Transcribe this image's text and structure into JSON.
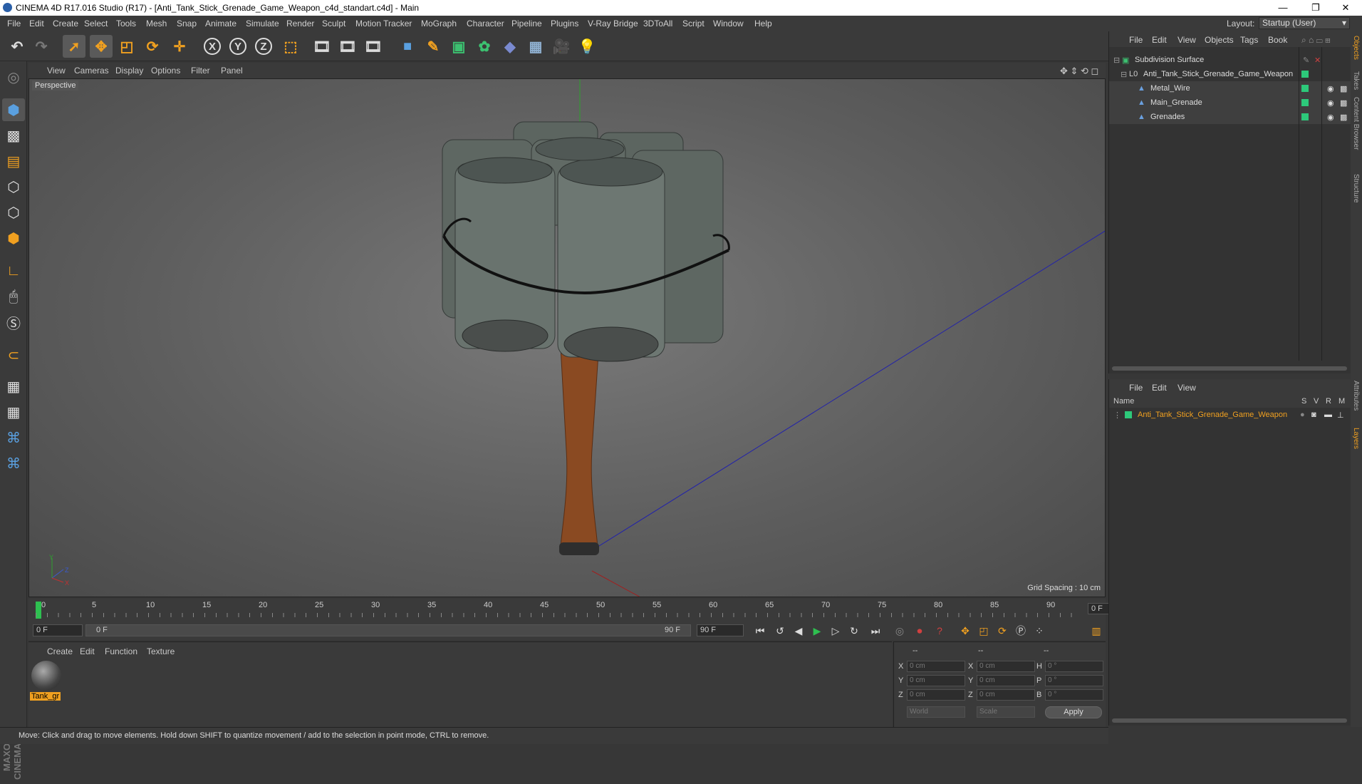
{
  "window": {
    "title": "CINEMA 4D R17.016 Studio (R17) - [Anti_Tank_Stick_Grenade_Game_Weapon_c4d_standart.c4d] - Main",
    "minimize": "—",
    "maximize": "❐",
    "close": "✕"
  },
  "menubar": {
    "items": [
      "File",
      "Edit",
      "Create",
      "Select",
      "Tools",
      "Mesh",
      "Snap",
      "Animate",
      "Simulate",
      "Render",
      "Sculpt",
      "Motion Tracker",
      "MoGraph",
      "Character",
      "Pipeline",
      "Plugins",
      "V-Ray Bridge",
      "3DToAll",
      "Script",
      "Window",
      "Help"
    ],
    "layout_label": "Layout:",
    "layout_value": "Startup (User)"
  },
  "toolbar": {
    "icons": [
      "undo-icon",
      "redo-icon",
      "select-arrow-icon",
      "move-icon",
      "scale-icon",
      "rotate-icon",
      "transform-icon",
      "x-axis-icon",
      "y-axis-icon",
      "z-axis-icon",
      "coord-system-icon",
      "render-view-icon",
      "render-picture-viewer-icon",
      "render-settings-icon",
      "cube-icon",
      "pen-icon",
      "subdivision-icon",
      "mograph-cloner-icon",
      "deformer-icon",
      "floor-icon",
      "camera-icon",
      "light-icon"
    ],
    "x": "X",
    "y": "Y",
    "z": "Z"
  },
  "viewport": {
    "menu": [
      "View",
      "Cameras",
      "Display",
      "Options",
      "Filter",
      "Panel"
    ],
    "label": "Perspective",
    "grid_spacing": "Grid Spacing : 10 cm",
    "axis_y": "Y",
    "axis_z": "Z",
    "axis_x": "X"
  },
  "timeline": {
    "ticks": [
      "0",
      "5",
      "10",
      "15",
      "20",
      "25",
      "30",
      "35",
      "40",
      "45",
      "50",
      "55",
      "60",
      "65",
      "70",
      "75",
      "80",
      "85",
      "90"
    ],
    "current_frame": "0 F"
  },
  "transport": {
    "start_field": "0 F",
    "range_start": "0 F",
    "range_end": "90 F",
    "end_field": "90 F"
  },
  "material_manager": {
    "menu": [
      "Create",
      "Edit",
      "Function",
      "Texture"
    ],
    "material_name": "Tank_gr"
  },
  "coordinates": {
    "header": [
      "--",
      "--",
      "--"
    ],
    "pos_labels": [
      "X",
      "Y",
      "Z"
    ],
    "size_labels": [
      "X",
      "Y",
      "Z"
    ],
    "rot_labels": [
      "H",
      "P",
      "B"
    ],
    "pos_values": [
      "0 cm",
      "0 cm",
      "0 cm"
    ],
    "size_values": [
      "0 cm",
      "0 cm",
      "0 cm"
    ],
    "rot_values": [
      "0 °",
      "0 °",
      "0 °"
    ],
    "mode_world": "World",
    "mode_scale": "Scale",
    "apply": "Apply"
  },
  "object_manager": {
    "menu": [
      "File",
      "Edit",
      "View",
      "Objects",
      "Tags",
      "Book"
    ],
    "objects": [
      {
        "name": "Subdivision Surface",
        "level": 0
      },
      {
        "name": "Anti_Tank_Stick_Grenade_Game_Weapon",
        "level": 1
      },
      {
        "name": "Metal_Wire",
        "level": 2
      },
      {
        "name": "Main_Grenade",
        "level": 2
      },
      {
        "name": "Grenades",
        "level": 2
      }
    ]
  },
  "layer_manager": {
    "menu": [
      "File",
      "Edit",
      "View"
    ],
    "header_name": "Name",
    "header_cols": [
      "S",
      "V",
      "R",
      "M"
    ],
    "layer_name": "Anti_Tank_Stick_Grenade_Game_Weapon",
    "layer_color": "#2dc97a"
  },
  "right_tabs": [
    "Objects",
    "Takes",
    "Content Browser",
    "Structure",
    "Attributes",
    "Layers"
  ],
  "statusbar": {
    "text": "Move: Click and drag to move elements. Hold down SHIFT to quantize movement / add to the selection in point mode, CTRL to remove."
  },
  "maxon_logo": "MAXON CINEMA 4D",
  "colors": {
    "accent_orange": "#f0a020",
    "layer_green": "#2dc97a",
    "panel_bg": "#3a3a3a"
  }
}
